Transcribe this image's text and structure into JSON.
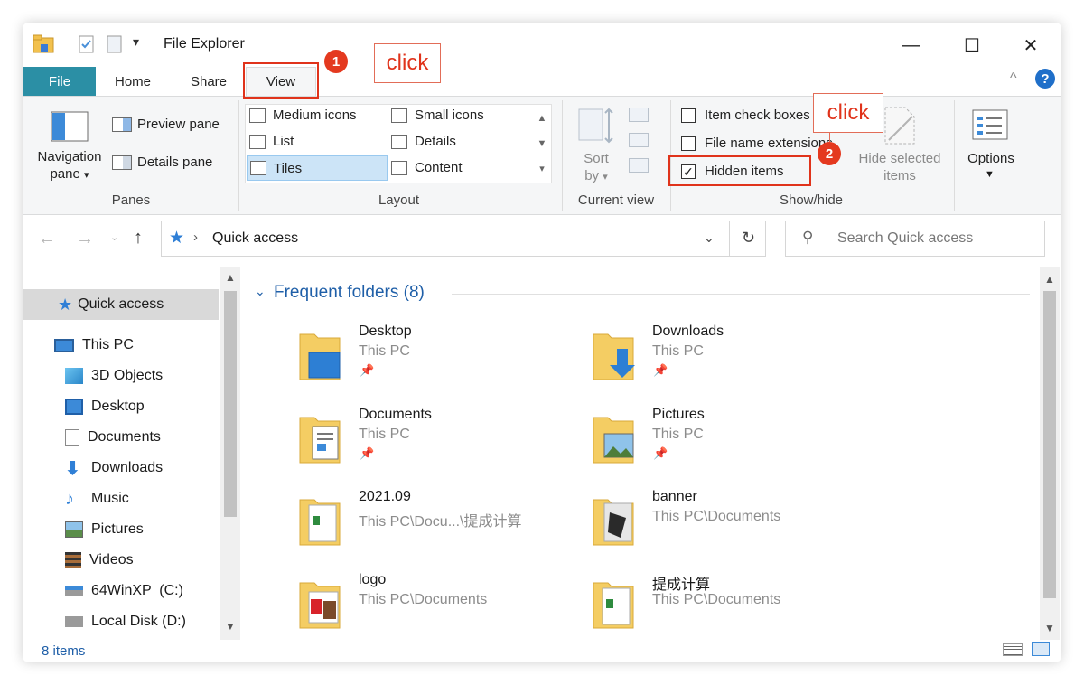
{
  "window": {
    "title": "File Explorer"
  },
  "tabs": {
    "file": "File",
    "home": "Home",
    "share": "Share",
    "view": "View"
  },
  "ribbon": {
    "panes": {
      "navigation_pane_line1": "Navigation",
      "navigation_pane_line2": "pane",
      "preview_pane": "Preview pane",
      "details_pane": "Details pane",
      "group_label": "Panes"
    },
    "layout": {
      "medium_icons": "Medium icons",
      "small_icons": "Small icons",
      "list": "List",
      "details": "Details",
      "tiles": "Tiles",
      "content": "Content",
      "group_label": "Layout"
    },
    "current_view": {
      "sort_line1": "Sort",
      "sort_line2": "by",
      "group_label": "Current view"
    },
    "show_hide": {
      "item_check_boxes": "Item check boxes",
      "file_name_extensions": "File name extensions",
      "hidden_items": "Hidden items",
      "hidden_items_checked": true,
      "hide_selected_line1": "Hide selected",
      "hide_selected_line2": "items",
      "group_label": "Show/hide"
    },
    "options": "Options"
  },
  "address": {
    "location": "Quick access",
    "search_placeholder": "Search Quick access"
  },
  "nav_pane": [
    {
      "label": "Quick access",
      "icon": "star-icon"
    },
    {
      "label": "This PC",
      "icon": "computer-icon"
    },
    {
      "label": "3D Objects",
      "icon": "cube-icon"
    },
    {
      "label": "Desktop",
      "icon": "desktop-icon"
    },
    {
      "label": "Documents",
      "icon": "document-icon"
    },
    {
      "label": "Downloads",
      "icon": "download-arrow-icon"
    },
    {
      "label": "Music",
      "icon": "music-note-icon"
    },
    {
      "label": "Pictures",
      "icon": "pictures-icon"
    },
    {
      "label": "Videos",
      "icon": "film-icon"
    },
    {
      "label": "64WinXP  (C:)",
      "icon": "drive-icon"
    },
    {
      "label": "Local Disk (D:)",
      "icon": "drive-icon"
    }
  ],
  "content": {
    "section_title": "Frequent folders (8)",
    "folders": [
      {
        "name": "Desktop",
        "location": "This PC",
        "pinned": true
      },
      {
        "name": "Downloads",
        "location": "This PC",
        "pinned": true
      },
      {
        "name": "Documents",
        "location": "This PC",
        "pinned": true
      },
      {
        "name": "Pictures",
        "location": "This PC",
        "pinned": true
      },
      {
        "name": "2021.09",
        "location": "This PC\\Docu...\\提成计算",
        "pinned": false
      },
      {
        "name": "banner",
        "location": "This PC\\Documents",
        "pinned": false
      },
      {
        "name": "logo",
        "location": "This PC\\Documents",
        "pinned": false
      },
      {
        "name": "提成计算",
        "location": "This PC\\Documents",
        "pinned": false
      }
    ]
  },
  "status": {
    "items": "8 items"
  },
  "annotations": {
    "badge1": "1",
    "click1": "click",
    "badge2": "2",
    "click2": "click"
  },
  "colors": {
    "file_tab": "#2b8fa5",
    "annotation_red": "#e0331b",
    "link_blue": "#1f5fa8",
    "selected_bg": "#cce4f7",
    "nav_selected_bg": "#d9d9d9"
  }
}
